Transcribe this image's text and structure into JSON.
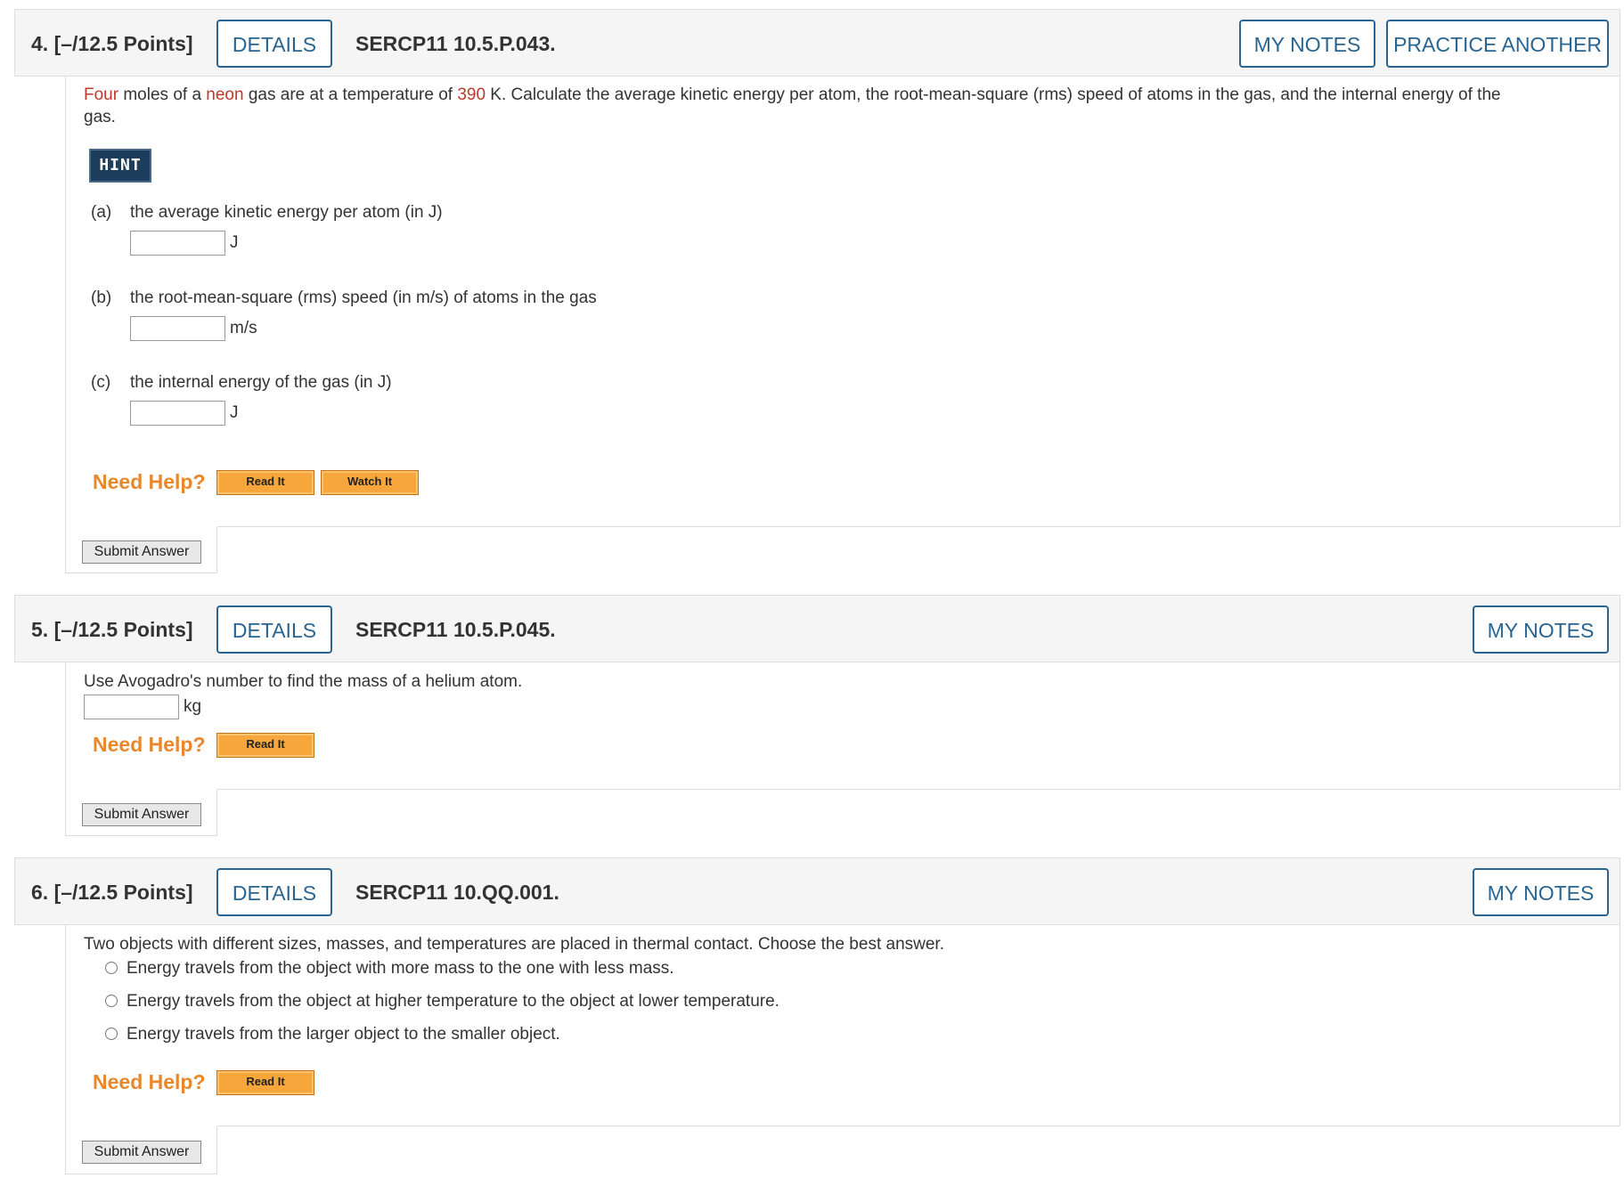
{
  "q4": {
    "number": "4.",
    "points": "[–/12.5 Points]",
    "details": "DETAILS",
    "code": "SERCP11 10.5.P.043.",
    "my_notes": "MY NOTES",
    "practice": "PRACTICE ANOTHER",
    "prompt": {
      "w1": "Four",
      "t1": " moles of a ",
      "w2": "neon",
      "t2": " gas are at a temperature of ",
      "w3": "390",
      "t3": " K. Calculate the average kinetic energy per atom, the root-mean-square (rms) speed of atoms in the gas, and the internal energy of the",
      "line2": "gas."
    },
    "hint": "HINT",
    "parts": [
      {
        "label": "(a)",
        "text": "the average kinetic energy per atom (in J)",
        "unit": "J",
        "value": ""
      },
      {
        "label": "(b)",
        "text": "the root-mean-square (rms) speed (in m/s) of atoms in the gas",
        "unit": "m/s",
        "value": ""
      },
      {
        "label": "(c)",
        "text": "the internal energy of the gas (in J)",
        "unit": "J",
        "value": ""
      }
    ],
    "need_help": "Need Help?",
    "read_it": "Read It",
    "watch_it": "Watch It",
    "submit": "Submit Answer"
  },
  "q5": {
    "number": "5.",
    "points": "[–/12.5 Points]",
    "details": "DETAILS",
    "code": "SERCP11 10.5.P.045.",
    "my_notes": "MY NOTES",
    "prompt": "Use Avogadro's number to find the mass of a helium atom.",
    "unit": "kg",
    "value": "",
    "need_help": "Need Help?",
    "read_it": "Read It",
    "submit": "Submit Answer"
  },
  "q6": {
    "number": "6.",
    "points": "[–/12.5 Points]",
    "details": "DETAILS",
    "code": "SERCP11 10.QQ.001.",
    "my_notes": "MY NOTES",
    "prompt": "Two objects with different sizes, masses, and temperatures are placed in thermal contact. Choose the best answer.",
    "options": [
      "Energy travels from the object with more mass to the one with less mass.",
      "Energy travels from the object at higher temperature to the object at lower temperature.",
      "Energy travels from the larger object to the smaller object."
    ],
    "need_help": "Need Help?",
    "read_it": "Read It",
    "submit": "Submit Answer"
  },
  "colors": {
    "accent": "#2a6591",
    "highlight": "#c0392b",
    "help": "#e8872b",
    "hint_bg": "#1d3d5c"
  }
}
